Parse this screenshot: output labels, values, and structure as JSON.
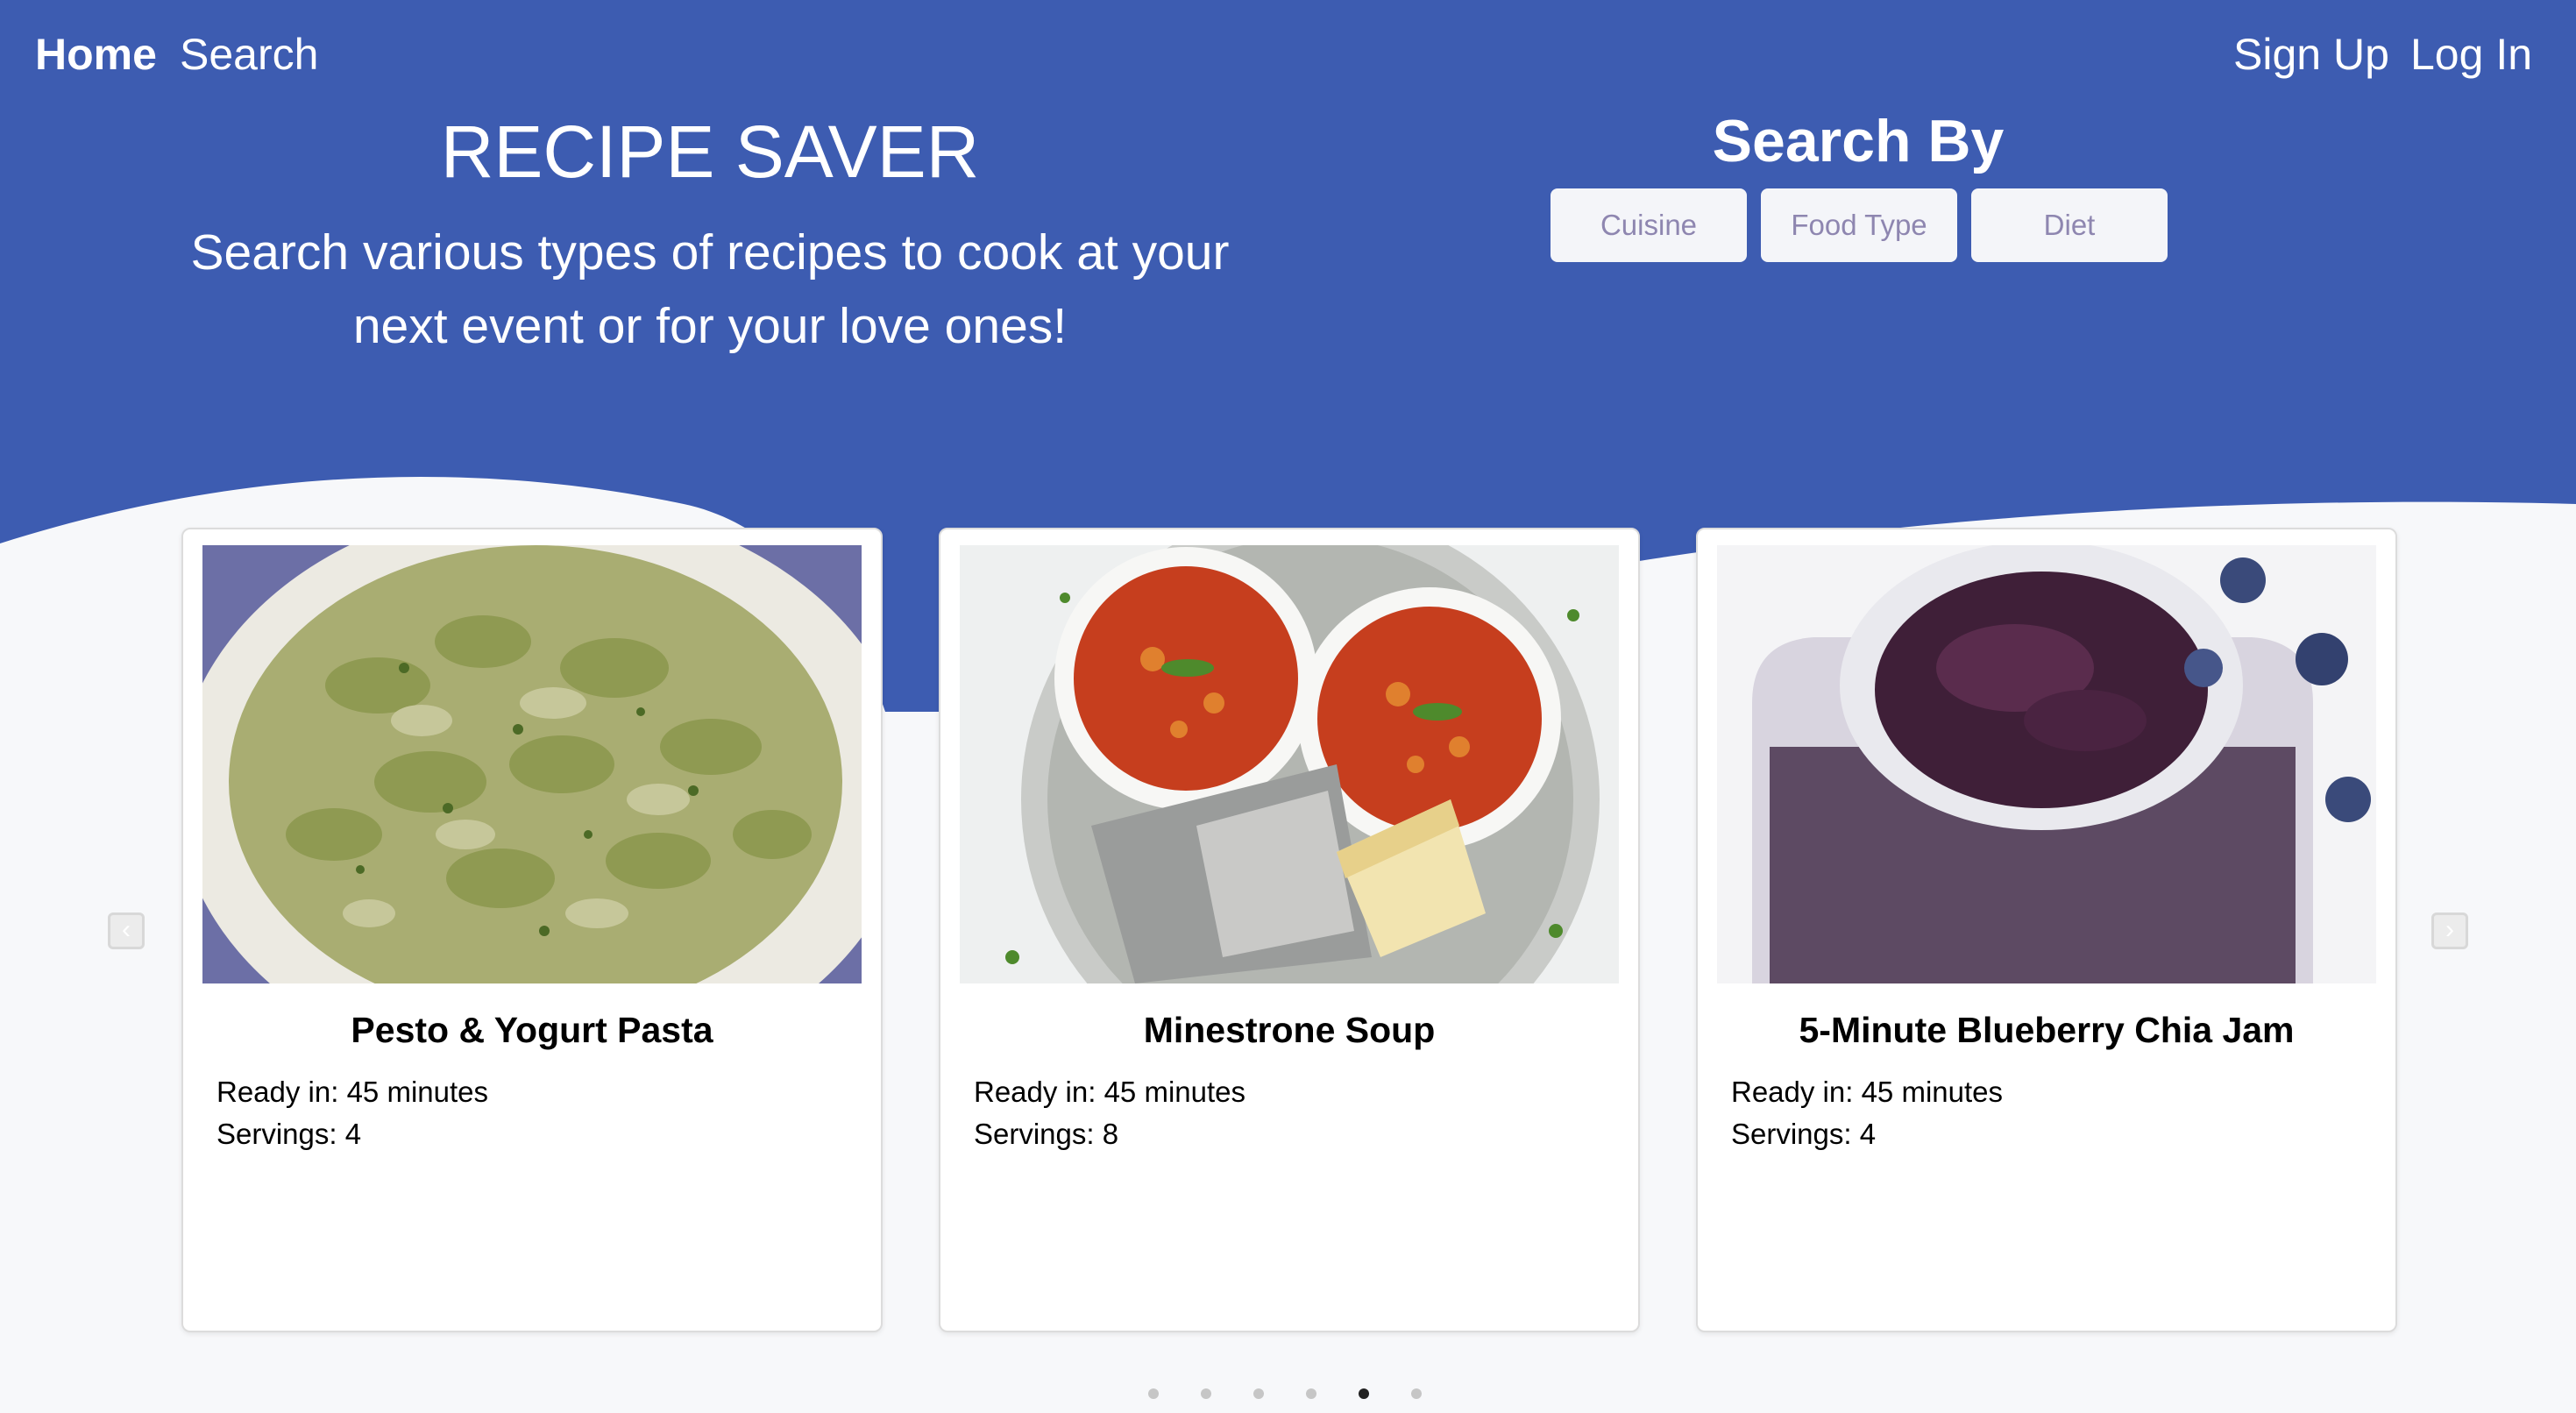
{
  "colors": {
    "hero": "#3d5cb1",
    "page_bg": "#f7f8fa",
    "button_bg": "#f4f5f9",
    "button_text": "#8e86b0"
  },
  "nav": {
    "home": "Home",
    "search": "Search",
    "sign_up": "Sign Up",
    "log_in": "Log In"
  },
  "hero": {
    "title": "RECIPE SAVER",
    "subtitle_line1": "Search various types of recipes to cook at your",
    "subtitle_line2": "next event or for your love ones!"
  },
  "search_by": {
    "title": "Search By",
    "buttons": [
      "Cuisine",
      "Food Type",
      "Diet"
    ]
  },
  "carousel": {
    "prev_icon": "chevron-left-icon",
    "next_icon": "chevron-right-icon",
    "cards": [
      {
        "title": "Pesto & Yogurt Pasta",
        "ready": "Ready in: 45 minutes",
        "servings": "Servings: 4",
        "image": "pasta-photo"
      },
      {
        "title": "Minestrone Soup",
        "ready": "Ready in: 45 minutes",
        "servings": "Servings: 8",
        "image": "soup-photo"
      },
      {
        "title": "5-Minute Blueberry Chia Jam",
        "ready": "Ready in: 45 minutes",
        "servings": "Servings: 4",
        "image": "jam-photo"
      }
    ],
    "dot_count": 6,
    "active_dot": 5
  }
}
